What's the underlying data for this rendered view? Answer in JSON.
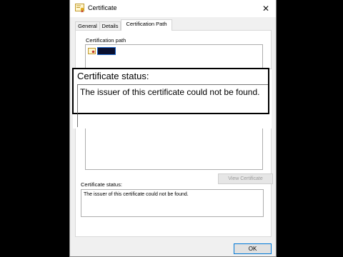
{
  "window": {
    "title": "Certificate",
    "close_glyph": "✕"
  },
  "tabs": [
    {
      "label": "General",
      "active": false
    },
    {
      "label": "Details",
      "active": false
    },
    {
      "label": "Certification Path",
      "active": true
    }
  ],
  "certification_path": {
    "label": "Certification path",
    "view_button_label": "View Certificate",
    "view_button_enabled": false
  },
  "status": {
    "label": "Certificate status:",
    "text": "The issuer of this certificate could not be found."
  },
  "footer": {
    "ok_label": "OK"
  },
  "zoom_callout": {
    "title": "Certificate status:",
    "text": "The issuer of this certificate could not be found."
  },
  "colors": {
    "selection_border": "#1d66c9",
    "ok_border": "#0078d7",
    "background": "#000000"
  },
  "icons": [
    "certificate-icon",
    "close-icon"
  ]
}
